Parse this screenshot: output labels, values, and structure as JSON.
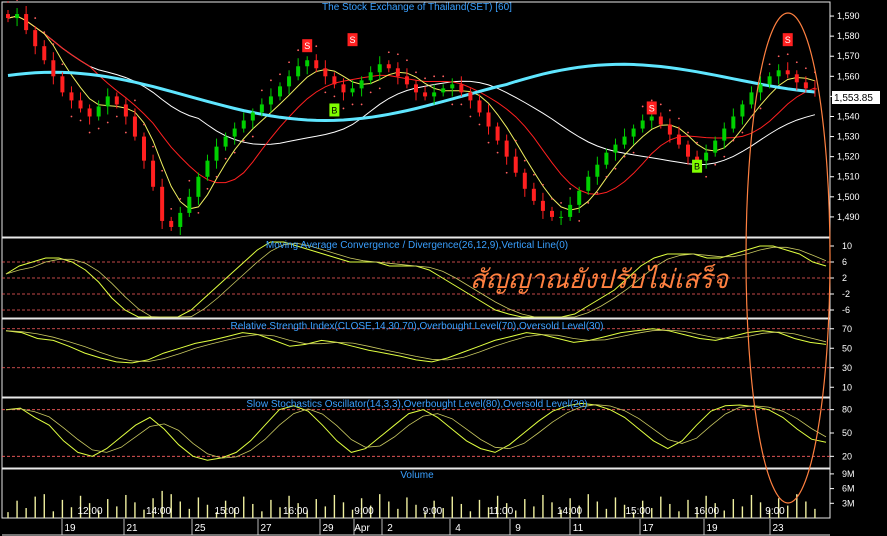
{
  "colors": {
    "background": "#000000",
    "panel_border": "#e8e8e8",
    "title_text": "#3aa0ff",
    "axis_text": "#ffffff",
    "up_candle": "#00d000",
    "down_candle": "#ff2020",
    "ma_long": "#5fe6ff",
    "ma_white": "#ffffff",
    "ma_red": "#ff2020",
    "ma_yellow": "#f0f060",
    "sar": "#ff6060",
    "osc_line": "#e0ff40",
    "osc_signal": "#c8c860",
    "level_line": "#ff6060",
    "volume_bar": "#f0f0a0",
    "annotation": "#ff8040",
    "sell_marker": "#ff2020",
    "buy_marker": "#80ff00"
  },
  "annotation_text": "สัญญาณยังปรับไม่เสร็จ",
  "last_price_label": "1,553.85",
  "chart_data": [
    {
      "type": "candlestick",
      "title": "The Stock Exchange of Thailand(SET) [60]",
      "y_ticks": [
        "1,590",
        "1,580",
        "1,570",
        "1,560",
        "1,550",
        "1,540",
        "1,530",
        "1,520",
        "1,510",
        "1,500",
        "1,490"
      ],
      "ylim": [
        1480,
        1597
      ],
      "closes": [
        1589,
        1591,
        1583,
        1575,
        1568,
        1560,
        1552,
        1548,
        1544,
        1540,
        1545,
        1550,
        1546,
        1540,
        1530,
        1518,
        1505,
        1488,
        1485,
        1492,
        1500,
        1510,
        1518,
        1525,
        1530,
        1534,
        1538,
        1542,
        1546,
        1550,
        1555,
        1560,
        1565,
        1568,
        1564,
        1560,
        1556,
        1552,
        1554,
        1558,
        1562,
        1566,
        1564,
        1560,
        1556,
        1552,
        1550,
        1552,
        1554,
        1556,
        1552,
        1548,
        1542,
        1535,
        1528,
        1520,
        1512,
        1504,
        1498,
        1493,
        1490,
        1490,
        1496,
        1503,
        1510,
        1516,
        1522,
        1526,
        1530,
        1534,
        1538,
        1540,
        1536,
        1531,
        1526,
        1520,
        1518,
        1522,
        1528,
        1534,
        1540,
        1546,
        1552,
        1556,
        1560,
        1563,
        1561,
        1557,
        1554,
        1553.85
      ],
      "buy_signals": [
        {
          "label": "B",
          "price": 1543
        },
        {
          "label": "B",
          "price": 1515
        }
      ],
      "sell_signals": [
        {
          "label": "S",
          "price": 1575
        },
        {
          "label": "S",
          "price": 1578
        },
        {
          "label": "S",
          "price": 1544
        },
        {
          "label": "S",
          "price": 1578
        }
      ]
    },
    {
      "type": "line",
      "title": "Moving Average Convergence / Divergence(26,12,9),Vertical Line(0)",
      "y_ticks": [
        "10",
        "6",
        "2",
        "-2",
        "-6"
      ],
      "ylim": [
        -8,
        12
      ],
      "levels": [
        6,
        2,
        -2,
        -6
      ],
      "series": [
        {
          "values": [
            3,
            5,
            6,
            7,
            7,
            6,
            4,
            1,
            -3,
            -6,
            -8,
            -9,
            -9,
            -8,
            -6,
            -3,
            0,
            3,
            6,
            9,
            11,
            11,
            10,
            9,
            8,
            7,
            6,
            6,
            6,
            5,
            5,
            5,
            4,
            2,
            0,
            -2,
            -4,
            -6,
            -7,
            -8,
            -9,
            -9,
            -8,
            -7,
            -5,
            -3,
            -1,
            2,
            5,
            7,
            8,
            8,
            8,
            7,
            7,
            8,
            9,
            10,
            10,
            9,
            8,
            6,
            5
          ]
        }
      ]
    },
    {
      "type": "line",
      "title": "Relative Strength Index(CLOSE,14,30,70),Overbought Level(70),Oversold Level(30)",
      "y_ticks": [
        "70",
        "50",
        "30",
        "10"
      ],
      "ylim": [
        0,
        80
      ],
      "levels": [
        70,
        30
      ],
      "series": [
        {
          "values": [
            68,
            66,
            60,
            58,
            52,
            45,
            40,
            36,
            35,
            38,
            45,
            50,
            55,
            58,
            62,
            66,
            64,
            58,
            52,
            54,
            58,
            56,
            52,
            48,
            45,
            42,
            38,
            36,
            40,
            46,
            52,
            58,
            62,
            66,
            64,
            60,
            56,
            58,
            62,
            66,
            68,
            70,
            68,
            64,
            60,
            58,
            62,
            66,
            68,
            66,
            60,
            56,
            54
          ]
        }
      ]
    },
    {
      "type": "line",
      "title": "Slow Stochastics Oscillator(14,3,3),Overbought Level(80),Oversold Level(20)",
      "y_ticks": [
        "80",
        "50",
        "20"
      ],
      "ylim": [
        5,
        95
      ],
      "levels": [
        80,
        20
      ],
      "series": [
        {
          "values": [
            80,
            82,
            70,
            60,
            40,
            25,
            20,
            30,
            45,
            60,
            70,
            55,
            35,
            20,
            15,
            18,
            25,
            40,
            60,
            80,
            85,
            78,
            60,
            40,
            25,
            30,
            45,
            60,
            75,
            80,
            70,
            55,
            40,
            30,
            25,
            35,
            50,
            65,
            78,
            85,
            88,
            86,
            80,
            70,
            55,
            40,
            30,
            40,
            60,
            78,
            85,
            86,
            84,
            80,
            70,
            55,
            42,
            38
          ]
        }
      ]
    },
    {
      "type": "bar",
      "title": "Volume",
      "y_ticks": [
        "9M",
        "6M",
        "3M"
      ],
      "ylim": [
        0,
        10
      ],
      "x_tick_labels": [
        "12:00",
        "14:00",
        "15:00",
        "16:00",
        "9:00",
        "9:00",
        "11:00",
        "14:00",
        "15:00",
        "16:00",
        "9:00"
      ],
      "date_labels": [
        "19",
        "21",
        "25",
        "27",
        "29",
        "Apr",
        "2",
        "4",
        "9",
        "11",
        "17",
        "19",
        "23"
      ]
    }
  ]
}
